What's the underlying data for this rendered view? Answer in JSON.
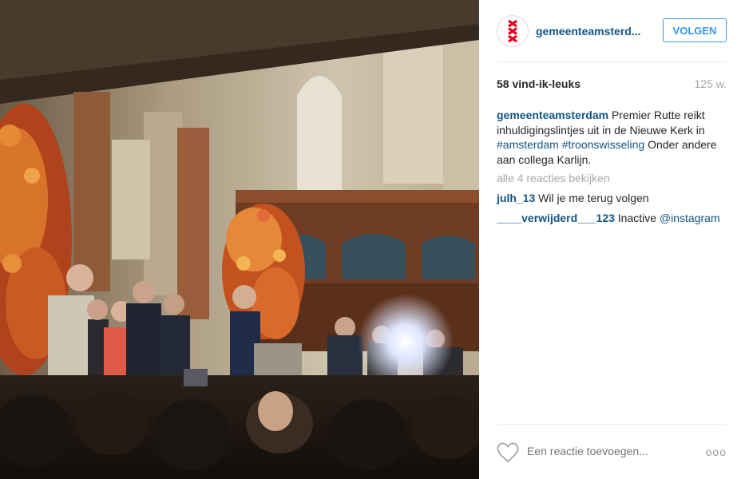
{
  "post": {
    "username": "gemeenteamsterd...",
    "follow_label": "VOLGEN",
    "likes": "58 vind-ik-leuks",
    "age": "125 w.",
    "caption": {
      "user": "gemeenteamsterdam",
      "text_1": " Premier Rutte reikt inhuldigingslintjes uit in de Nieuwe Kerk in ",
      "tag_1": "#amsterdam",
      "text_2": " ",
      "tag_2": "#troonswisseling",
      "text_3": " Onder andere aan collega Karlijn."
    },
    "view_all": "alle 4 reacties bekijken",
    "comments": [
      {
        "user": "julh_13",
        "text": " Wil je me terug volgen"
      },
      {
        "user": "____verwijderd___123",
        "text": " Inactive ",
        "mention": "@instagram"
      }
    ],
    "add_comment_placeholder": "Een reactie toevoegen...",
    "more_label": "ooo"
  },
  "icons": {
    "avatar": "amsterdam-crosses-icon",
    "like": "heart-outline-icon",
    "more": "ellipsis-icon"
  },
  "colors": {
    "link": "#125688",
    "follow": "#3897f0",
    "muted": "#a5a7aa",
    "crosses": "#e2001a"
  }
}
